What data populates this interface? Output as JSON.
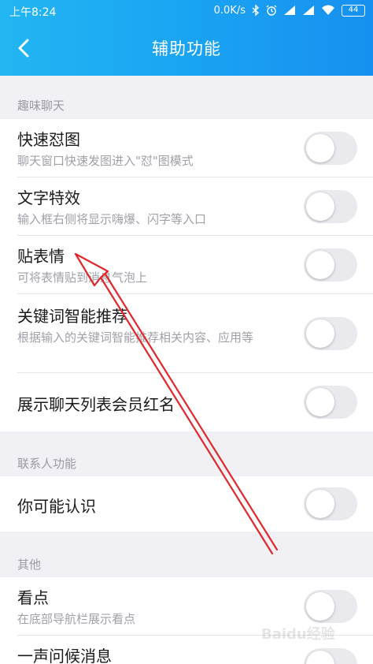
{
  "status_bar": {
    "time": "上午8:24",
    "speed": "0.0K/s",
    "battery": "44"
  },
  "header": {
    "title": "辅助功能"
  },
  "sections": [
    {
      "title": "趣味聊天",
      "items": [
        {
          "label": "快速怼图",
          "desc": "聊天窗口快速发图进入\"怼\"图模式",
          "enabled": false
        },
        {
          "label": "文字特效",
          "desc": "输入框右侧将显示嗨爆、闪字等入口",
          "enabled": false
        },
        {
          "label": "贴表情",
          "desc": "可将表情贴到消息气泡上",
          "enabled": false
        },
        {
          "label": "关键词智能推荐",
          "desc": "根据输入的关键词智能推荐相关内容、应用等",
          "enabled": false
        },
        {
          "label": "展示聊天列表会员红名",
          "desc": "",
          "enabled": false
        }
      ]
    },
    {
      "title": "联系人功能",
      "items": [
        {
          "label": "你可能认识",
          "desc": "",
          "enabled": false
        }
      ]
    },
    {
      "title": "其他",
      "items": [
        {
          "label": "看点",
          "desc": "在底部导航栏展示看点",
          "enabled": false
        },
        {
          "label": "一声问候消息",
          "desc": "",
          "enabled": false
        }
      ]
    }
  ],
  "watermark": "Baidu经验",
  "colors": {
    "header_start": "#22b6f3",
    "header_end": "#1690f0",
    "annotation_arrow": "#e0272b"
  }
}
